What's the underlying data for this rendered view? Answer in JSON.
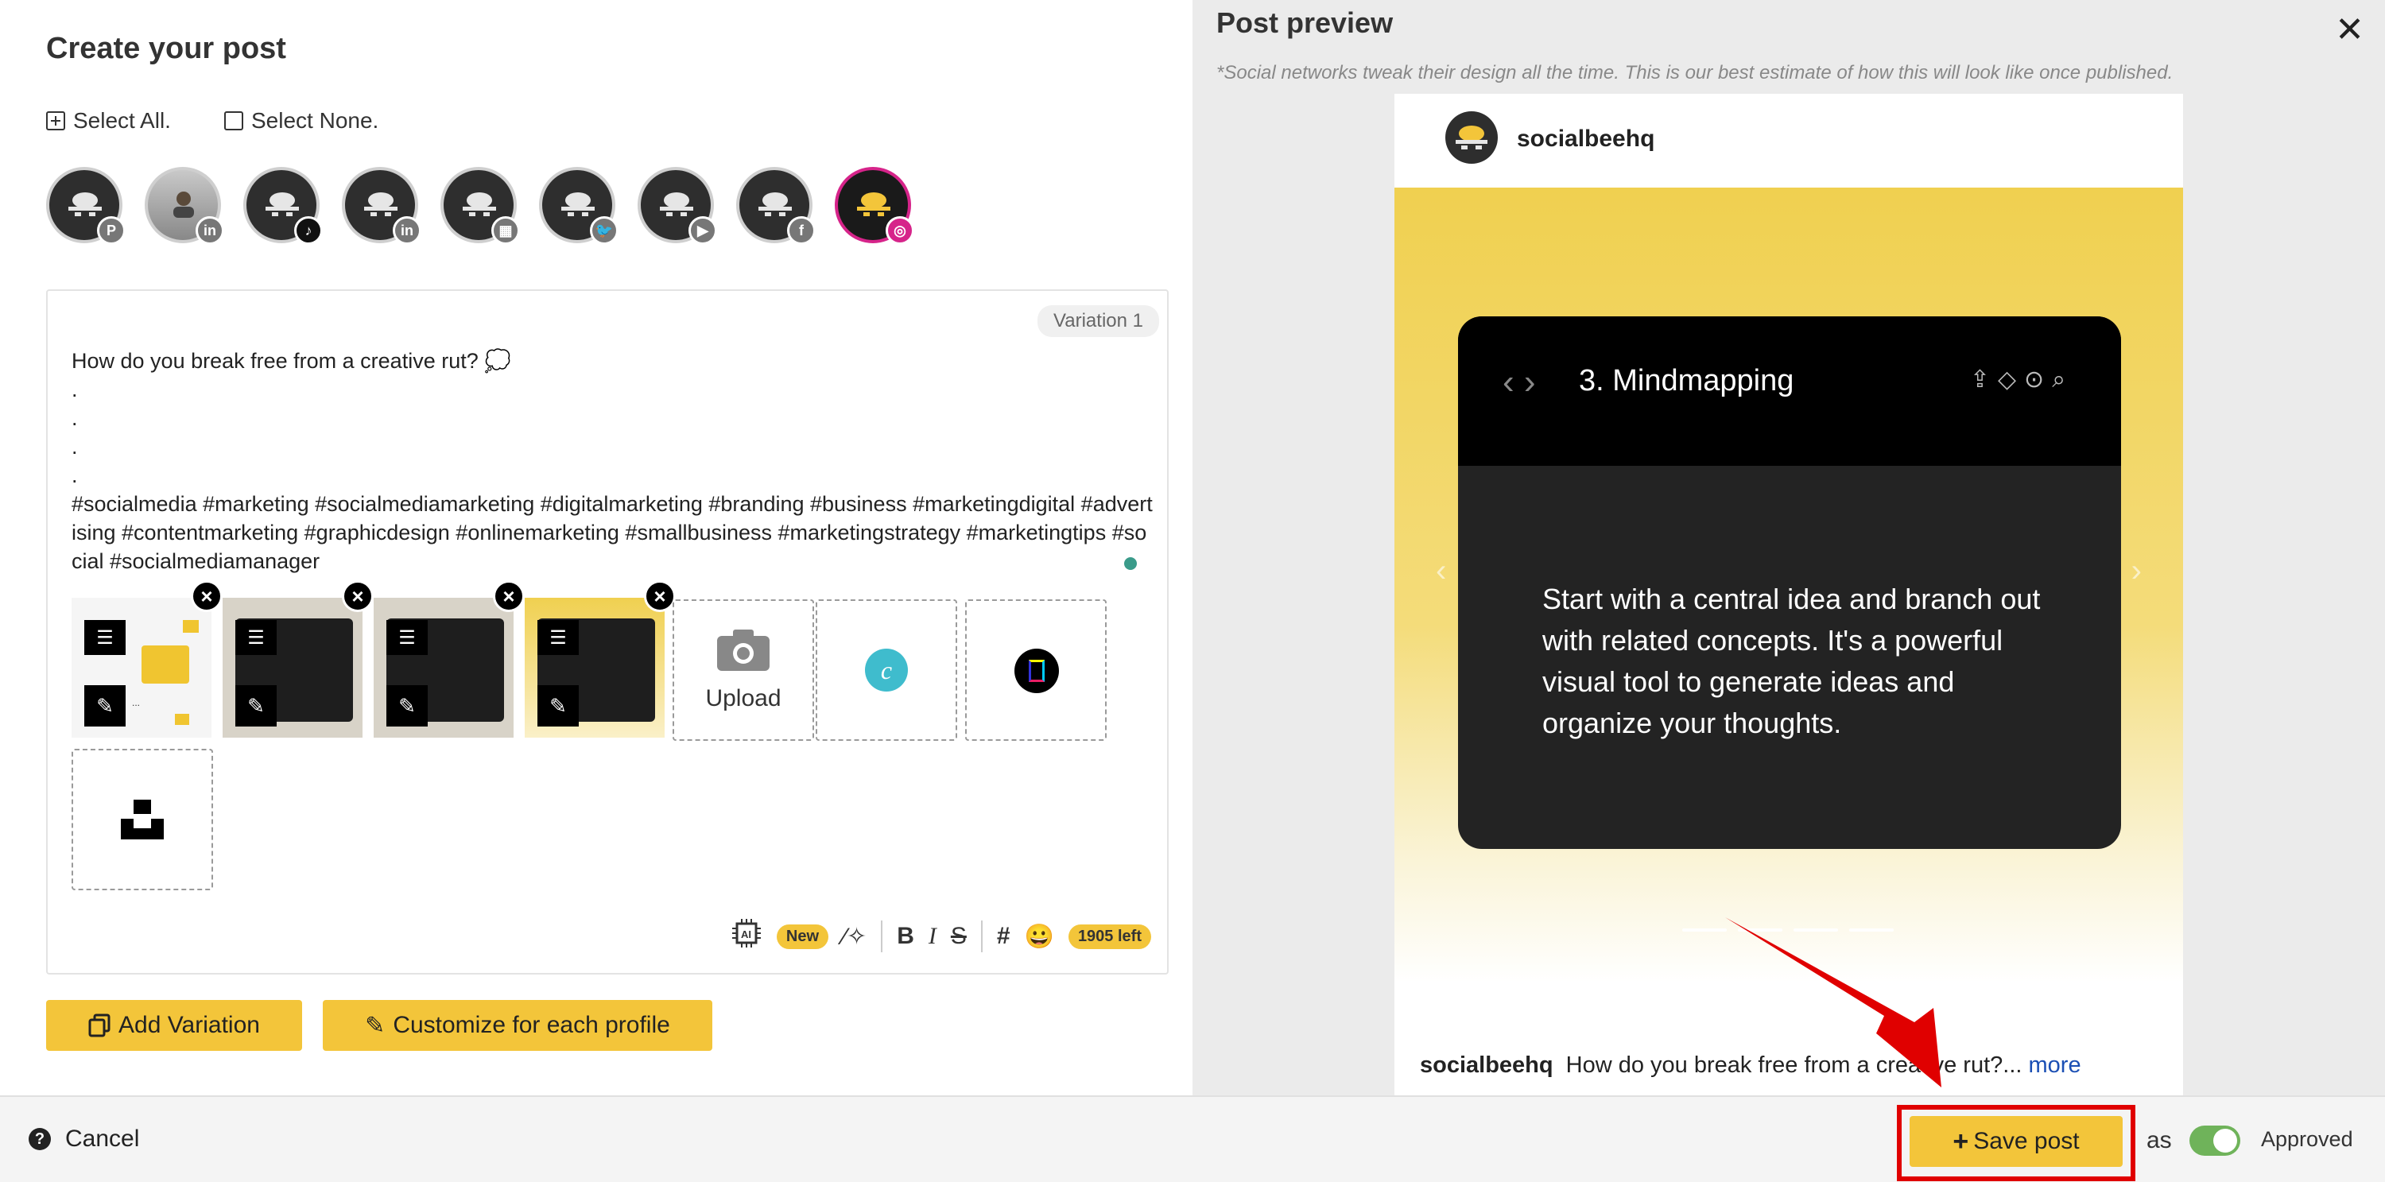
{
  "left": {
    "title": "Create your post",
    "select_all": "Select All.",
    "select_none": "Select None.",
    "profiles": [
      {
        "network": "pinterest",
        "badge": "P"
      },
      {
        "network": "linkedin-personal",
        "badge": "in"
      },
      {
        "network": "tiktok",
        "badge": "♪"
      },
      {
        "network": "linkedin",
        "badge": "in"
      },
      {
        "network": "google-business",
        "badge": "▦"
      },
      {
        "network": "twitter",
        "badge": "🐦"
      },
      {
        "network": "youtube",
        "badge": "▶"
      },
      {
        "network": "facebook",
        "badge": "f"
      },
      {
        "network": "instagram",
        "badge": "◎"
      }
    ],
    "editor": {
      "variation_tag": "Variation 1",
      "post_text": "How do you break free from a creative rut? 💭\n.\n.\n.\n.\n#socialmedia #marketing #socialmediamarketing #digitalmarketing #branding #business #marketingdigital #advertising #contentmarketing #graphicdesign #onlinemarketing #smallbusiness #marketingstrategy #marketingtips #social #socialmediamanager",
      "upload_label": "Upload",
      "ai_pill": "New",
      "chars_left": "1905 left"
    },
    "add_variation": "Add Variation",
    "customize": "Customize for each profile"
  },
  "preview": {
    "title": "Post preview",
    "note": "*Social networks tweak their design all the time. This is our best estimate of how this will look like once published.",
    "username": "socialbeehq",
    "card_title": "3. Mindmapping",
    "card_body": "Start with a central idea and branch out with related concepts. It's a powerful visual tool to generate ideas and organize your thoughts.",
    "caption_user": "socialbeehq",
    "caption_text": "How do you break free from a creative rut?...",
    "more": "more"
  },
  "bottom": {
    "cancel": "Cancel",
    "save": "Save post",
    "as": "as",
    "approved": "Approved"
  },
  "colors": {
    "accent_yellow": "#f3c53a",
    "highlight_red": "#e00000",
    "toggle_green": "#6fb35a",
    "instagram_pink": "#d6248a"
  }
}
